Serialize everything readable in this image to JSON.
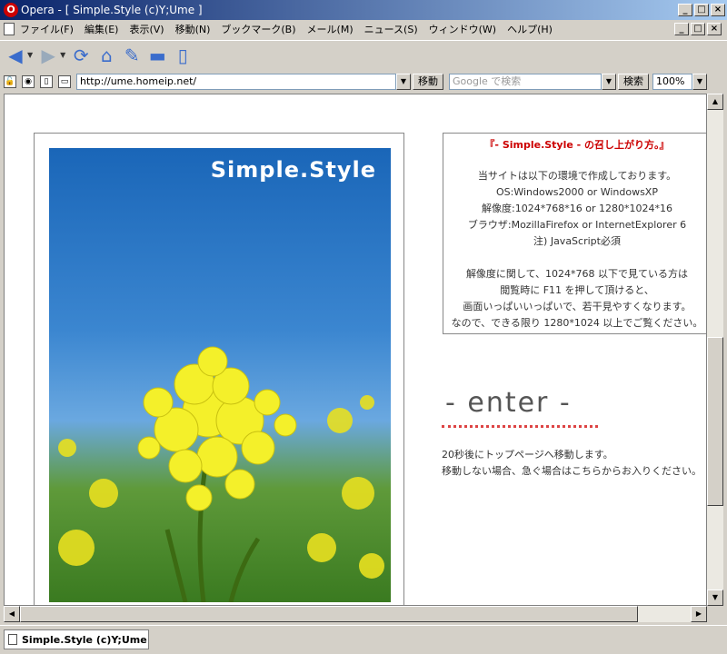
{
  "window": {
    "title": "Opera - [ Simple.Style (c)Y;Ume ]",
    "buttons": [
      "_",
      "□",
      "×"
    ]
  },
  "menubar": {
    "items": [
      "ファイル(F)",
      "編集(E)",
      "表示(V)",
      "移動(N)",
      "ブックマーク(B)",
      "メール(M)",
      "ニュース(S)",
      "ウィンドウ(W)",
      "ヘルプ(H)"
    ]
  },
  "address": {
    "url": "http://ume.homeip.net/",
    "go_label": "移動",
    "search_placeholder": "Google で検索",
    "search_label": "検索",
    "zoom": "100%"
  },
  "page": {
    "logo": "Simple.Style",
    "info": {
      "heading": "『- Simple.Style - の召し上がり方。』",
      "lines": [
        "",
        "当サイトは以下の環境で作成しております。",
        "OS:Windows2000 or WindowsXP",
        "解像度:1024*768*16 or 1280*1024*16",
        "ブラウザ:MozillaFirefox or InternetExplorer 6",
        "注) JavaScript必須",
        "",
        "解像度に関して、1024*768 以下で見ている方は",
        "閲覧時に F11 を押して頂けると、",
        "画面いっぱいいっぱいで、若干見やすくなります。",
        "なので、できる限り 1280*1024 以上でご覧ください。"
      ]
    },
    "enter": "- enter -",
    "redirect": [
      "20秒後にトップページへ移動します。",
      "移動しない場合、急ぐ場合はこちらからお入りください。"
    ]
  },
  "taskbar": {
    "tab_label": "Simple.Style (c)Y;Ume"
  }
}
